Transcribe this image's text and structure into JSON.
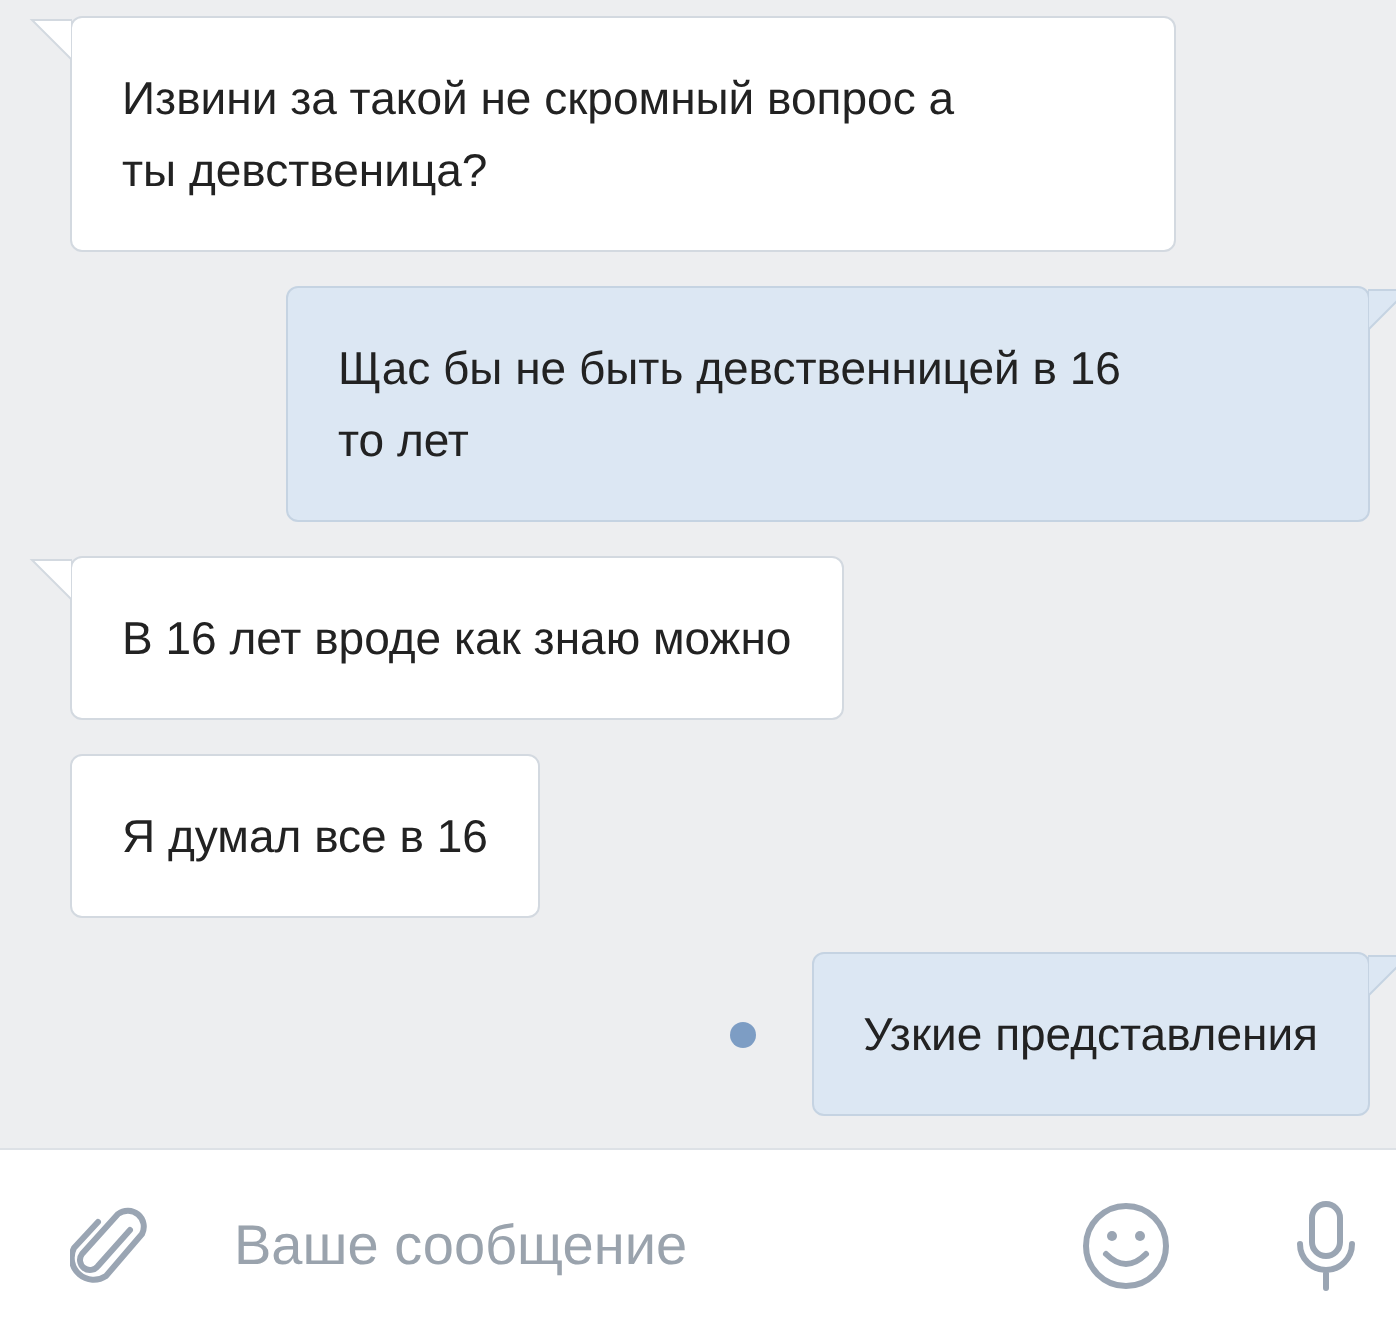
{
  "messages": [
    {
      "kind": "in",
      "text": "Извини за такой не скромный вопрос а ты девственица?",
      "tail": true,
      "unread": false
    },
    {
      "kind": "out",
      "text": "Щас бы не быть девственницей в 16 то лет",
      "tail": true,
      "unread": false
    },
    {
      "kind": "in",
      "text": "В 16 лет вроде как знаю можно",
      "tail": true,
      "unread": false
    },
    {
      "kind": "in",
      "text": "Я думал все в 16",
      "tail": false,
      "unread": false
    },
    {
      "kind": "out",
      "text": "Узкие представления",
      "tail": true,
      "unread": true
    }
  ],
  "composer": {
    "placeholder": "Ваше сообщение"
  }
}
